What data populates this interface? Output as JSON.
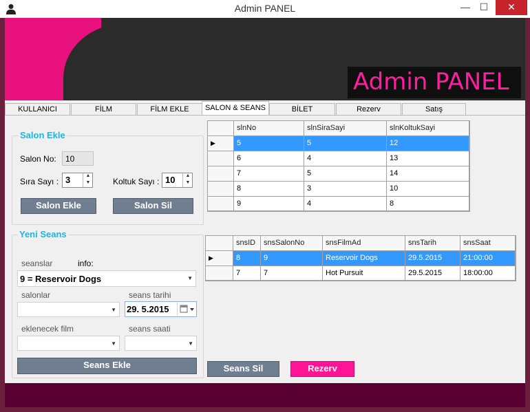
{
  "window": {
    "title": "Admin PANEL",
    "min_glyph": "—",
    "max_glyph": "☐",
    "close_glyph": "✕"
  },
  "banner": {
    "title": "Admin PANEL"
  },
  "tabs": [
    {
      "label": "KULLANICI"
    },
    {
      "label": "FİLM"
    },
    {
      "label": "FİLM EKLE"
    },
    {
      "label": "SALON & SEANS",
      "active": true
    },
    {
      "label": "BİLET"
    },
    {
      "label": "Rezerv"
    },
    {
      "label": "Satış"
    }
  ],
  "salon_ekle": {
    "legend": "Salon Ekle",
    "salon_no_label": "Salon No:",
    "salon_no_value": "10",
    "sira_label": "Sıra Sayı :",
    "sira_value": "3",
    "koltuk_label": "Koltuk Sayı :",
    "koltuk_value": "10",
    "add_button": "Salon Ekle",
    "delete_button": "Salon Sil"
  },
  "yeni_seans": {
    "legend": "Yeni Seans",
    "seanslar_label": "seanslar",
    "info_label": "info:",
    "seans_combo_value": "9  =  Reservoir Dogs",
    "salonlar_label": "salonlar",
    "seans_tarihi_label": "seans tarihi",
    "date_value": "29.  5.2015",
    "eklenecek_film_label": "eklenecek film",
    "seans_saati_label": "seans saati",
    "add_button": "Seans Ekle"
  },
  "salon_grid": {
    "columns": [
      "slnNo",
      "slnSiraSayi",
      "slnKoltukSayi"
    ],
    "rows": [
      [
        "5",
        "5",
        "12"
      ],
      [
        "6",
        "4",
        "13"
      ],
      [
        "7",
        "5",
        "14"
      ],
      [
        "8",
        "3",
        "10"
      ],
      [
        "9",
        "4",
        "8"
      ]
    ],
    "selected_row": 0
  },
  "seans_grid": {
    "columns": [
      "snsID",
      "snsSalonNo",
      "snsFilmAd",
      "snsTarih",
      "snsSaat"
    ],
    "rows": [
      [
        "8",
        "9",
        "Reservoir Dogs",
        "29.5.2015",
        "21:00:00"
      ],
      [
        "7",
        "7",
        "Hot Pursuit",
        "29.5.2015",
        "18:00:00"
      ]
    ],
    "selected_row": 0
  },
  "actions": {
    "seans_sil": "Seans Sil",
    "rezerv": "Rezerv"
  },
  "colors": {
    "accent_pink": "#e9117e",
    "legend_blue": "#1fb5dc",
    "button_slate": "#6f7f91",
    "selection_blue": "#3399ff",
    "frame_maroon": "#6b1f3c"
  }
}
